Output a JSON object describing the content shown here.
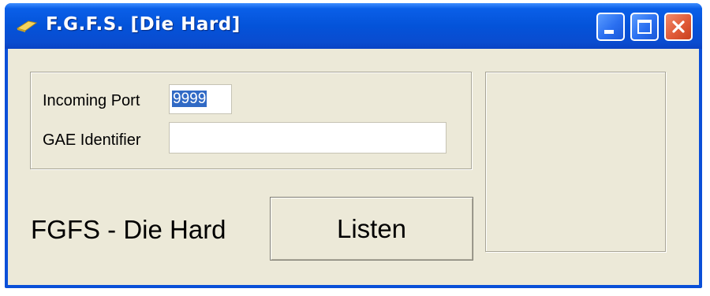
{
  "window": {
    "title": "F.G.F.S. [Die Hard]"
  },
  "titlebar_buttons": {
    "minimize": "minimize-icon",
    "maximize": "maximize-icon",
    "close": "close-icon"
  },
  "form": {
    "incoming_port_label": "Incoming Port",
    "incoming_port_value": "9999",
    "gae_identifier_label": "GAE Identifier",
    "gae_identifier_value": ""
  },
  "footer": {
    "app_label": "FGFS - Die Hard",
    "listen_button_label": "Listen"
  },
  "colors": {
    "titlebar": "#0453d9",
    "window_background": "#ece9d8",
    "close_button": "#e05a38",
    "selection": "#316ac5"
  }
}
